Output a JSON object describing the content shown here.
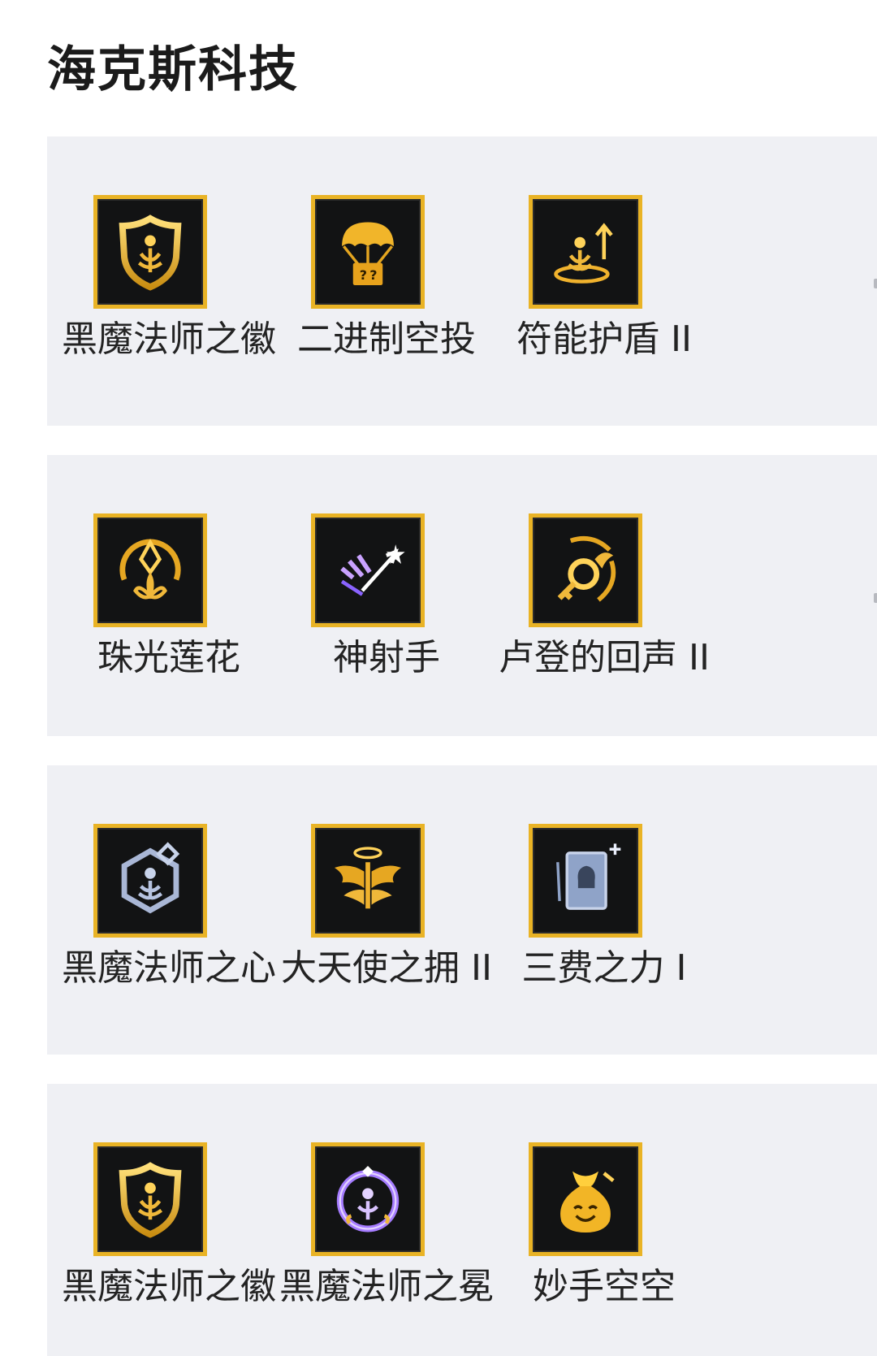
{
  "page": {
    "title": "海克斯科技"
  },
  "rows": [
    {
      "items": [
        {
          "label": "黑魔法师之徽",
          "icon": "shield-emblem-icon"
        },
        {
          "label": "二进制空投",
          "icon": "parachute-box-icon"
        },
        {
          "label": "符能护盾 II",
          "icon": "rising-emblem-icon"
        }
      ]
    },
    {
      "items": [
        {
          "label": "珠光莲花",
          "icon": "lotus-icon"
        },
        {
          "label": "神射手",
          "icon": "arrow-burst-icon"
        },
        {
          "label": "卢登的回声 II",
          "icon": "echo-orb-icon"
        }
      ]
    },
    {
      "items": [
        {
          "label": "黑魔法师之心",
          "icon": "hex-heart-icon"
        },
        {
          "label": "大天使之拥 II",
          "icon": "winged-halo-icon"
        },
        {
          "label": "三费之力 I",
          "icon": "card-plus-icon"
        }
      ]
    },
    {
      "items": [
        {
          "label": "黑魔法师之徽",
          "icon": "shield-emblem-icon"
        },
        {
          "label": "黑魔法师之冕",
          "icon": "crown-ring-icon"
        },
        {
          "label": "妙手空空",
          "icon": "money-bag-icon"
        }
      ]
    }
  ],
  "colors": {
    "accent_gold": "#e9b325",
    "row_bg": "#eff0f4",
    "tile_bg": "#121314",
    "text": "#232323"
  }
}
